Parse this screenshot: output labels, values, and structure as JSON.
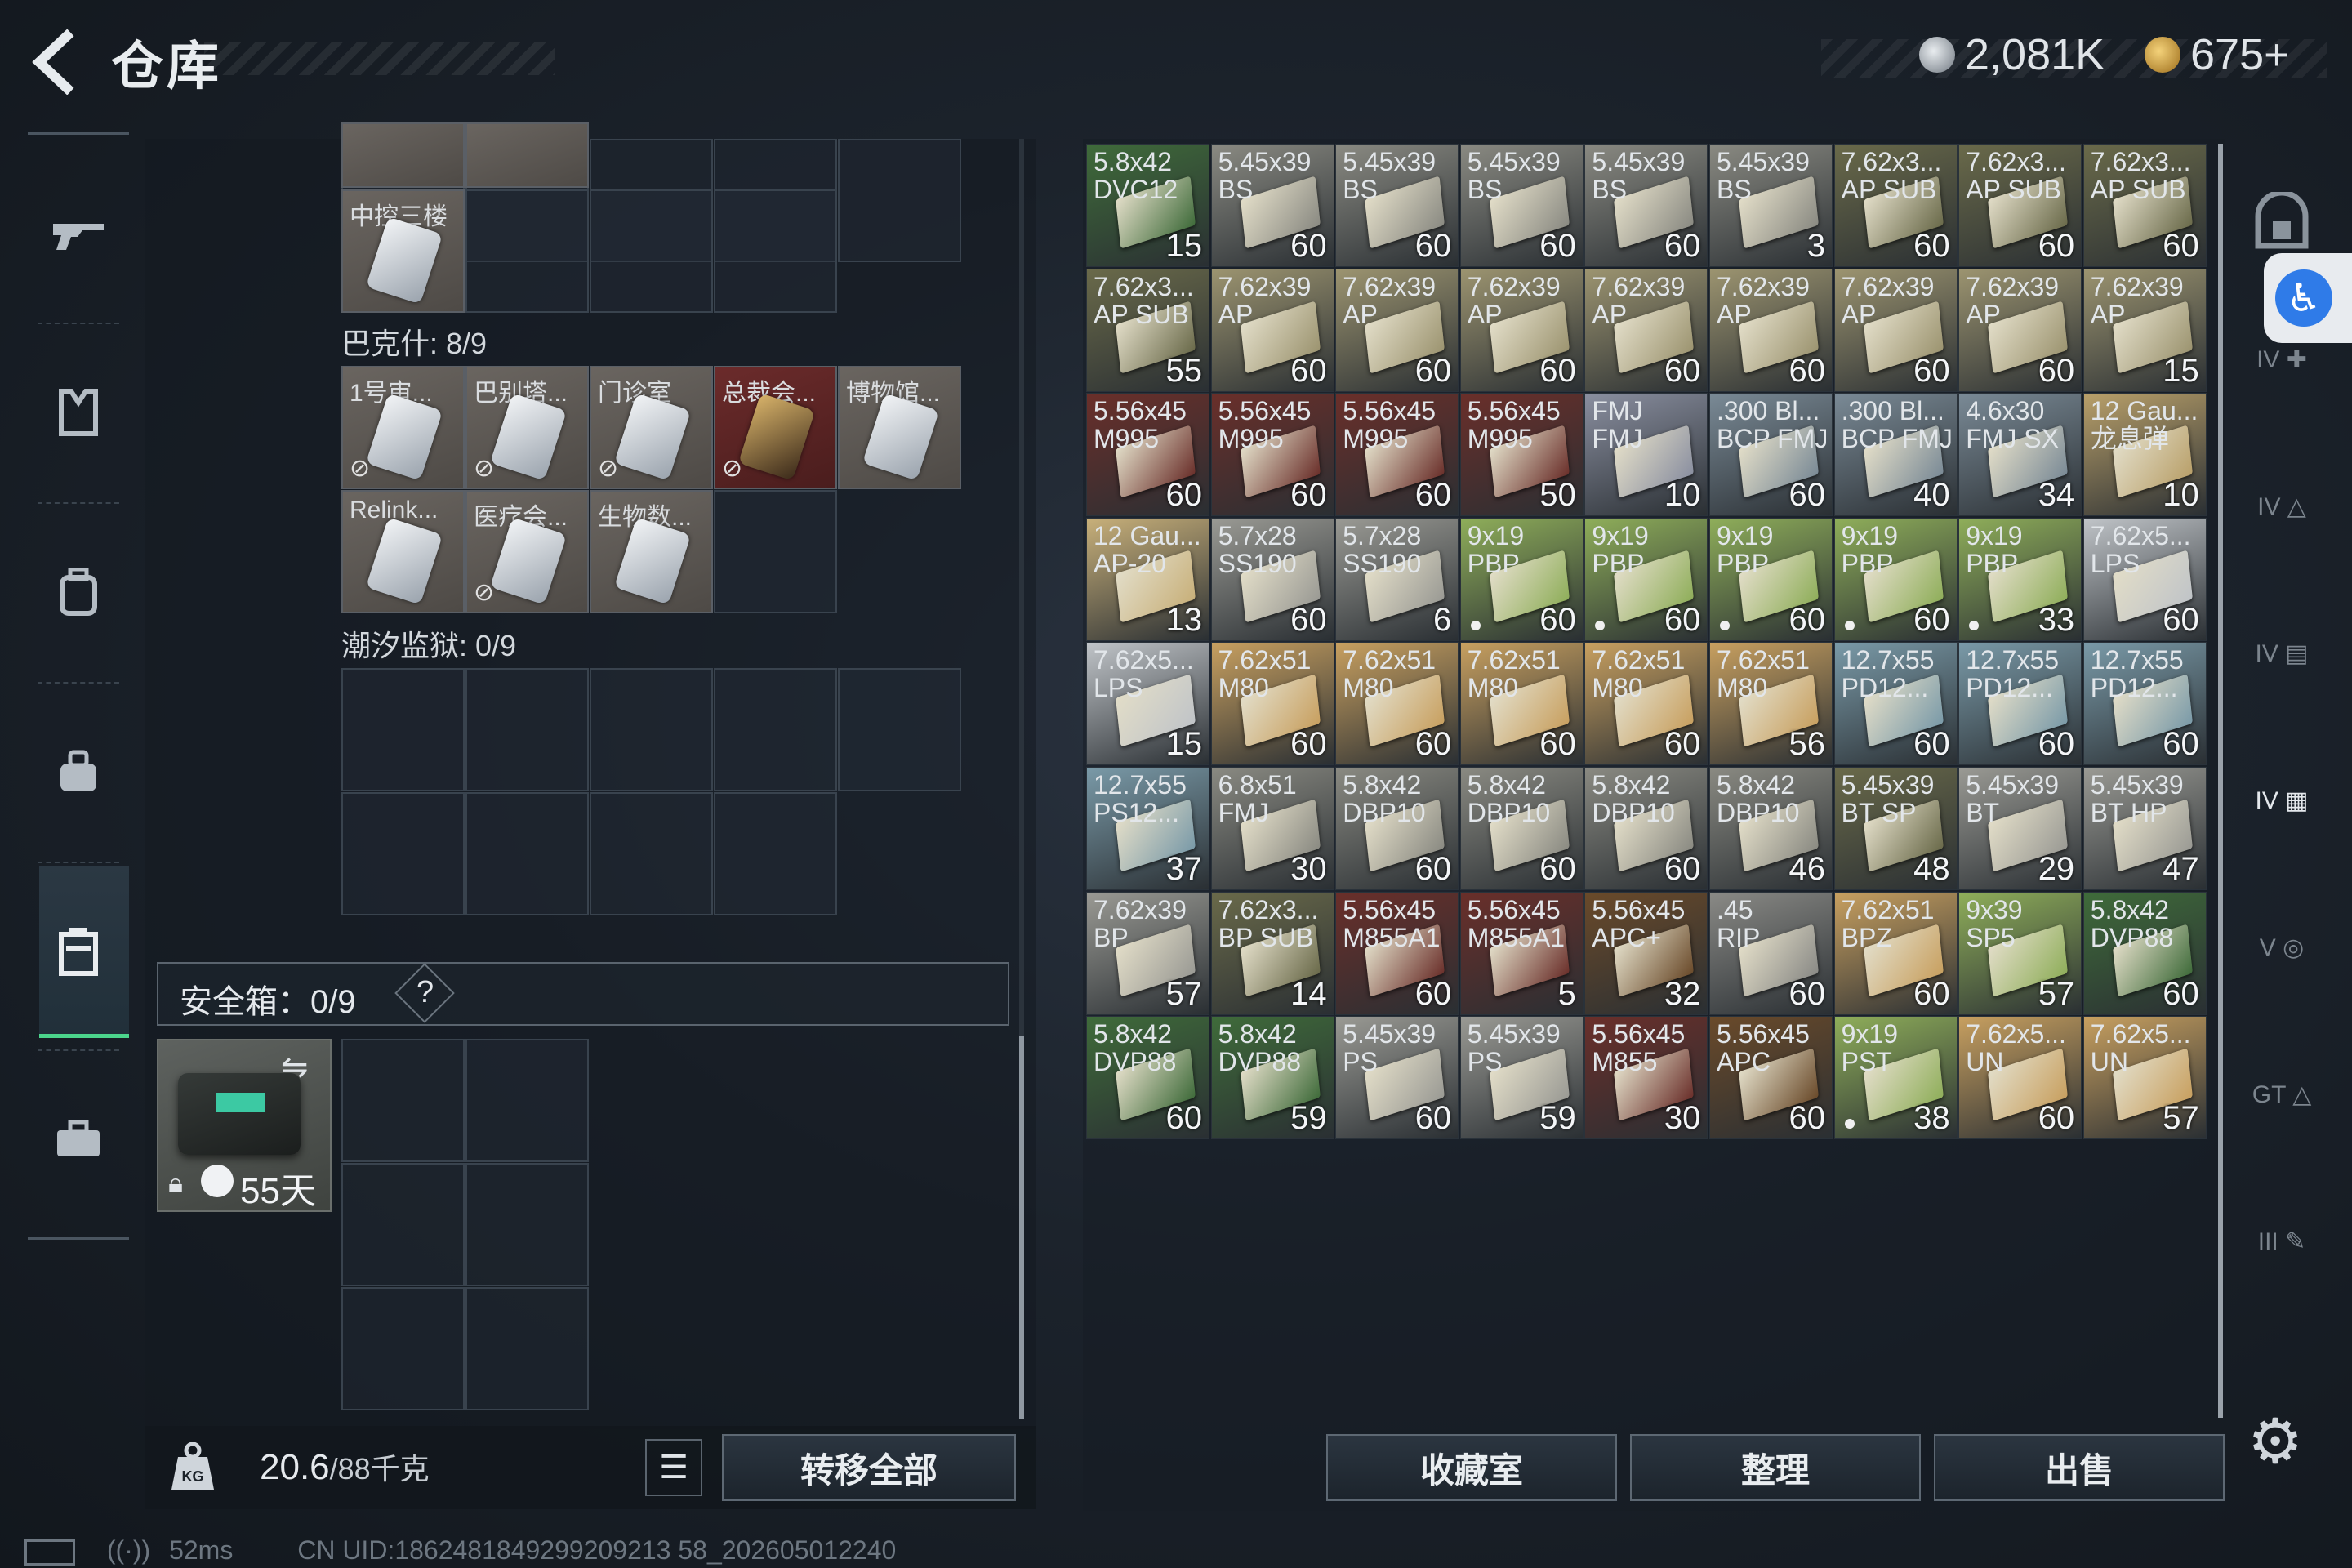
{
  "header": {
    "title": "仓库",
    "currency1": "2,081K",
    "currency2": "675+"
  },
  "nav": {
    "items": [
      "gun-icon",
      "armor-icon",
      "backpack-icon",
      "rig-icon",
      "case-icon",
      "briefcase-icon"
    ],
    "active_index": 4
  },
  "left": {
    "section_bakesh": "巴克什: 8/9",
    "section_prison": "潮汐监狱: 0/9",
    "top_card_label": "中控三楼",
    "bakesh_cards": [
      {
        "label": "1号审...",
        "red": false,
        "nodrop": true
      },
      {
        "label": "巴别塔...",
        "red": false,
        "nodrop": true
      },
      {
        "label": "门诊室",
        "red": false,
        "nodrop": true
      },
      {
        "label": "总裁会...",
        "red": true,
        "nodrop": true
      },
      {
        "label": "博物馆...",
        "red": false,
        "nodrop": false
      },
      {
        "label": "Relink...",
        "red": false,
        "nodrop": false
      },
      {
        "label": "医疗会...",
        "red": false,
        "nodrop": true
      },
      {
        "label": "生物数...",
        "red": false,
        "nodrop": false
      }
    ],
    "safe_label": "安全箱：0/9",
    "safe_help": "?",
    "safe_days": "55天",
    "weight_value": "20.6",
    "weight_max": "/88千克",
    "transfer_label": "转移全部"
  },
  "ammo": [
    {
      "cal": "5.8x42",
      "typ": "DVC12",
      "cnt": "15",
      "color": "#3f6b3a"
    },
    {
      "cal": "5.45x39",
      "typ": "BS",
      "cnt": "60",
      "color": "#8a8a82"
    },
    {
      "cal": "5.45x39",
      "typ": "BS",
      "cnt": "60",
      "color": "#8a8a82"
    },
    {
      "cal": "5.45x39",
      "typ": "BS",
      "cnt": "60",
      "color": "#8a8a82"
    },
    {
      "cal": "5.45x39",
      "typ": "BS",
      "cnt": "60",
      "color": "#8a8a82"
    },
    {
      "cal": "5.45x39",
      "typ": "BS",
      "cnt": "3",
      "color": "#8a8a82"
    },
    {
      "cal": "7.62x3...",
      "typ": "AP SUB",
      "cnt": "60",
      "color": "#6a6a4a"
    },
    {
      "cal": "7.62x3...",
      "typ": "AP SUB",
      "cnt": "60",
      "color": "#6a6a4a"
    },
    {
      "cal": "7.62x3...",
      "typ": "AP SUB",
      "cnt": "60",
      "color": "#6a6a4a"
    },
    {
      "cal": "7.62x3...",
      "typ": "AP SUB",
      "cnt": "55",
      "color": "#6a6a4a"
    },
    {
      "cal": "7.62x39",
      "typ": "AP",
      "cnt": "60",
      "color": "#9c9470"
    },
    {
      "cal": "7.62x39",
      "typ": "AP",
      "cnt": "60",
      "color": "#9c9470"
    },
    {
      "cal": "7.62x39",
      "typ": "AP",
      "cnt": "60",
      "color": "#9c9470"
    },
    {
      "cal": "7.62x39",
      "typ": "AP",
      "cnt": "60",
      "color": "#9c9470"
    },
    {
      "cal": "7.62x39",
      "typ": "AP",
      "cnt": "60",
      "color": "#9c9470"
    },
    {
      "cal": "7.62x39",
      "typ": "AP",
      "cnt": "60",
      "color": "#9c9470"
    },
    {
      "cal": "7.62x39",
      "typ": "AP",
      "cnt": "60",
      "color": "#9c9470"
    },
    {
      "cal": "7.62x39",
      "typ": "AP",
      "cnt": "15",
      "color": "#9c9470"
    },
    {
      "cal": "5.56x45",
      "typ": "M995",
      "cnt": "60",
      "color": "#6a2f2a"
    },
    {
      "cal": "5.56x45",
      "typ": "M995",
      "cnt": "60",
      "color": "#6a2f2a"
    },
    {
      "cal": "5.56x45",
      "typ": "M995",
      "cnt": "60",
      "color": "#6a2f2a"
    },
    {
      "cal": "5.56x45",
      "typ": "M995",
      "cnt": "50",
      "color": "#6a2f2a"
    },
    {
      "cal": "FMJ",
      "typ": "FMJ",
      "cnt": "10",
      "color": "#8a8fa0"
    },
    {
      "cal": ".300 Bl...",
      "typ": "BCP FMJ",
      "cnt": "60",
      "color": "#7a8a96"
    },
    {
      "cal": ".300 Bl...",
      "typ": "BCP FMJ",
      "cnt": "40",
      "color": "#7a8a96"
    },
    {
      "cal": "4.6x30",
      "typ": "FMJ SX",
      "cnt": "34",
      "color": "#7a8a96"
    },
    {
      "cal": "12 Gau...",
      "typ": "龙息弹",
      "cnt": "10",
      "color": "#b9a06a"
    },
    {
      "cal": "12 Gau...",
      "typ": "AP-20",
      "cnt": "13",
      "color": "#c8b07a"
    },
    {
      "cal": "5.7x28",
      "typ": "SS190",
      "cnt": "60",
      "color": "#9a9a94"
    },
    {
      "cal": "5.7x28",
      "typ": "SS190",
      "cnt": "6",
      "color": "#9a9a94"
    },
    {
      "cal": "9x19",
      "typ": "PBP",
      "cnt": "60",
      "color": "#8fae5a",
      "dot": true
    },
    {
      "cal": "9x19",
      "typ": "PBP",
      "cnt": "60",
      "color": "#8fae5a",
      "dot": true
    },
    {
      "cal": "9x19",
      "typ": "PBP",
      "cnt": "60",
      "color": "#8fae5a",
      "dot": true
    },
    {
      "cal": "9x19",
      "typ": "PBP",
      "cnt": "60",
      "color": "#8fae5a",
      "dot": true
    },
    {
      "cal": "9x19",
      "typ": "PBP",
      "cnt": "33",
      "color": "#8fae5a",
      "dot": true
    },
    {
      "cal": "7.62x5...",
      "typ": "LPS",
      "cnt": "60",
      "color": "#c0c4c8"
    },
    {
      "cal": "7.62x5...",
      "typ": "LPS",
      "cnt": "15",
      "color": "#c0c4c8"
    },
    {
      "cal": "7.62x51",
      "typ": "M80",
      "cnt": "60",
      "color": "#c8a060"
    },
    {
      "cal": "7.62x51",
      "typ": "M80",
      "cnt": "60",
      "color": "#c8a060"
    },
    {
      "cal": "7.62x51",
      "typ": "M80",
      "cnt": "60",
      "color": "#c8a060"
    },
    {
      "cal": "7.62x51",
      "typ": "M80",
      "cnt": "60",
      "color": "#c8a060"
    },
    {
      "cal": "7.62x51",
      "typ": "M80",
      "cnt": "56",
      "color": "#c8a060"
    },
    {
      "cal": "12.7x55",
      "typ": "PD12...",
      "cnt": "60",
      "color": "#7a9aa8"
    },
    {
      "cal": "12.7x55",
      "typ": "PD12...",
      "cnt": "60",
      "color": "#7a9aa8"
    },
    {
      "cal": "12.7x55",
      "typ": "PD12...",
      "cnt": "60",
      "color": "#7a9aa8"
    },
    {
      "cal": "12.7x55",
      "typ": "PS12...",
      "cnt": "37",
      "color": "#7a9aa8"
    },
    {
      "cal": "6.8x51",
      "typ": "FMJ",
      "cnt": "30",
      "color": "#8a8a82"
    },
    {
      "cal": "5.8x42",
      "typ": "DBP10",
      "cnt": "60",
      "color": "#8a8a82"
    },
    {
      "cal": "5.8x42",
      "typ": "DBP10",
      "cnt": "60",
      "color": "#8a8a82"
    },
    {
      "cal": "5.8x42",
      "typ": "DBP10",
      "cnt": "60",
      "color": "#8a8a82"
    },
    {
      "cal": "5.8x42",
      "typ": "DBP10",
      "cnt": "46",
      "color": "#8a8a82"
    },
    {
      "cal": "5.45x39",
      "typ": "BT SP",
      "cnt": "48",
      "color": "#6a6a4a"
    },
    {
      "cal": "5.45x39",
      "typ": "BT",
      "cnt": "29",
      "color": "#9a9a94"
    },
    {
      "cal": "5.45x39",
      "typ": "BT HP",
      "cnt": "47",
      "color": "#9a9a94"
    },
    {
      "cal": "7.62x39",
      "typ": "BP",
      "cnt": "57",
      "color": "#9a9a94"
    },
    {
      "cal": "7.62x3...",
      "typ": "BP SUB",
      "cnt": "14",
      "color": "#6a6a4a"
    },
    {
      "cal": "5.56x45",
      "typ": "M855A1",
      "cnt": "60",
      "color": "#6a2f2a"
    },
    {
      "cal": "5.56x45",
      "typ": "M855A1",
      "cnt": "5",
      "color": "#6a2f2a"
    },
    {
      "cal": "5.56x45",
      "typ": "APC+",
      "cnt": "32",
      "color": "#6a4a2a"
    },
    {
      "cal": ".45",
      "typ": "RIP",
      "cnt": "60",
      "color": "#8a8a86"
    },
    {
      "cal": "7.62x51",
      "typ": "BPZ",
      "cnt": "60",
      "color": "#c8a060"
    },
    {
      "cal": "9x39",
      "typ": "SP5",
      "cnt": "57",
      "color": "#8fae5a"
    },
    {
      "cal": "5.8x42",
      "typ": "DVP88",
      "cnt": "60",
      "color": "#3f6b3a"
    },
    {
      "cal": "5.8x42",
      "typ": "DVP88",
      "cnt": "60",
      "color": "#3f6b3a"
    },
    {
      "cal": "5.8x42",
      "typ": "DVP88",
      "cnt": "59",
      "color": "#3f6b3a"
    },
    {
      "cal": "5.45x39",
      "typ": "PS",
      "cnt": "60",
      "color": "#9a9a94"
    },
    {
      "cal": "5.45x39",
      "typ": "PS",
      "cnt": "59",
      "color": "#9a9a94"
    },
    {
      "cal": "5.56x45",
      "typ": "M855",
      "cnt": "30",
      "color": "#6a2f2a"
    },
    {
      "cal": "5.56x45",
      "typ": "APC",
      "cnt": "60",
      "color": "#6a4a2a"
    },
    {
      "cal": "9x19",
      "typ": "PST",
      "cnt": "38",
      "color": "#8fae5a",
      "dot": true
    },
    {
      "cal": "7.62x5...",
      "typ": "UN",
      "cnt": "60",
      "color": "#c8a060"
    },
    {
      "cal": "7.62x5...",
      "typ": "UN",
      "cnt": "57",
      "color": "#c8a060"
    }
  ],
  "right_buttons": {
    "collection": "收藏室",
    "sort": "整理",
    "sell": "出售"
  },
  "status": {
    "ping": "52ms",
    "uid": "CN UID:1862481849299209213 58_202605012240"
  }
}
